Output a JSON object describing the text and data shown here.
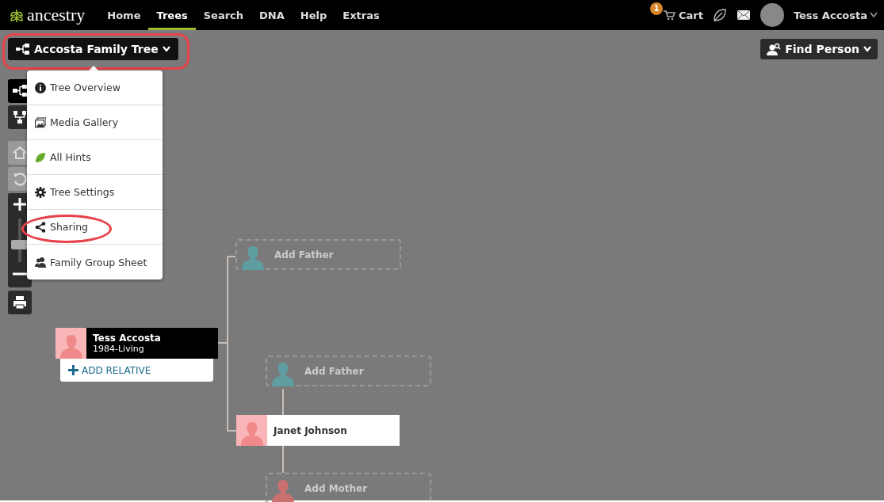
{
  "top_nav": {
    "logo": "ancestry",
    "items": [
      {
        "label": "Home",
        "selected": false
      },
      {
        "label": "Trees",
        "selected": true
      },
      {
        "label": "Search",
        "selected": false
      },
      {
        "label": "DNA",
        "selected": false
      },
      {
        "label": "Help",
        "selected": false
      },
      {
        "label": "Extras",
        "selected": false
      }
    ],
    "cart": {
      "label": "Cart",
      "badge": "1"
    },
    "user": "Tess Accosta"
  },
  "tree_menu_button": {
    "label": "Accosta Family Tree",
    "highlighted": true
  },
  "find_person": {
    "label": "Find Person"
  },
  "tree_menu": {
    "expanded": true,
    "items": [
      {
        "label": "Tree Overview",
        "highlighted": false
      },
      {
        "label": "Media Gallery",
        "highlighted": false
      },
      {
        "label": "All Hints",
        "highlighted": false
      },
      {
        "label": "Tree Settings",
        "highlighted": false
      },
      {
        "label": "Sharing",
        "highlighted": true
      },
      {
        "label": "Family Group Sheet",
        "highlighted": false
      }
    ]
  },
  "side_tools": [
    {
      "kind": "tree-view",
      "selected": true,
      "disabled": false
    },
    {
      "kind": "pedigree-view",
      "selected": false,
      "disabled": false
    },
    {
      "kind": "home",
      "selected": false,
      "disabled": true
    },
    {
      "kind": "undo",
      "selected": false,
      "disabled": true
    },
    {
      "kind": "zoom",
      "level": 0.45
    },
    {
      "kind": "print",
      "selected": false,
      "disabled": false
    }
  ],
  "tree": {
    "people": [
      {
        "kind": "person",
        "name": "Tess Accosta",
        "dates": "1984-Living",
        "selected": true,
        "color": "#f08a8a",
        "action": "ADD RELATIVE"
      },
      {
        "kind": "placeholder",
        "name": "Add Father",
        "color": "#5f9ea0"
      },
      {
        "kind": "placeholder",
        "name": "Add Father",
        "color": "#5f9ea0"
      },
      {
        "kind": "person",
        "name": "Janet Johnson",
        "selected": false,
        "color": "#f08a8a"
      },
      {
        "kind": "placeholder",
        "name": "Add Mother",
        "color": "#c97070"
      }
    ]
  }
}
